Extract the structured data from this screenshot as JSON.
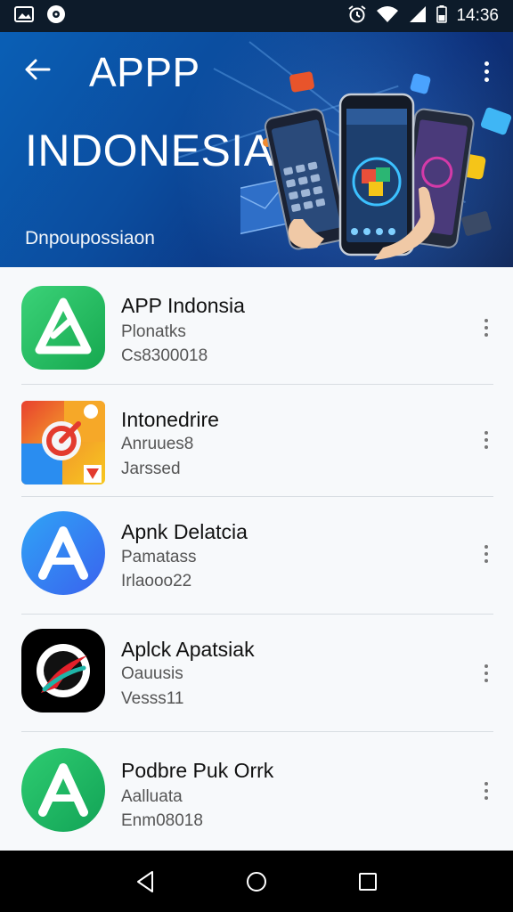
{
  "status_bar": {
    "time": "14:36",
    "icons": [
      "gallery-icon",
      "media-icon",
      "alarm-icon",
      "wifi-icon",
      "signal-icon",
      "battery-icon"
    ]
  },
  "header": {
    "title": "APPP",
    "subtitle": "INDONESIA",
    "caption": "Dnpoupossiaon",
    "icons": [
      "back-arrow-icon",
      "more-vert-icon"
    ]
  },
  "apps": [
    {
      "name": "APP Indonsia",
      "line1": "Plonatks",
      "line2": "Cs8300018",
      "icon": "triangle-a-icon",
      "colors": [
        "#1fb95a",
        "#39d172"
      ]
    },
    {
      "name": "Intonedrire",
      "line1": "Anruues8",
      "line2": "Jarssed",
      "icon": "target-dial-icon",
      "colors": [
        "#f2a02c",
        "#e33b2e"
      ]
    },
    {
      "name": "Apnk Delatcia",
      "line1": "Pamatass",
      "line2": "Irlaooo22",
      "icon": "letter-a-icon",
      "colors": [
        "#1f8ef0",
        "#3a6bf0"
      ]
    },
    {
      "name": "Aplck Apatsiak",
      "line1": "Oauusis",
      "line2": "Vesss11",
      "icon": "swoosh-circle-icon",
      "colors": [
        "#000000",
        "#e3202a"
      ]
    },
    {
      "name": "Podbre Puk Orrk",
      "line1": "Aalluata",
      "line2": "Enm08018",
      "icon": "letter-a-icon",
      "colors": [
        "#17a65a",
        "#2fc66e"
      ]
    }
  ],
  "nav": [
    "back-nav-icon",
    "home-nav-icon",
    "recents-nav-icon"
  ]
}
